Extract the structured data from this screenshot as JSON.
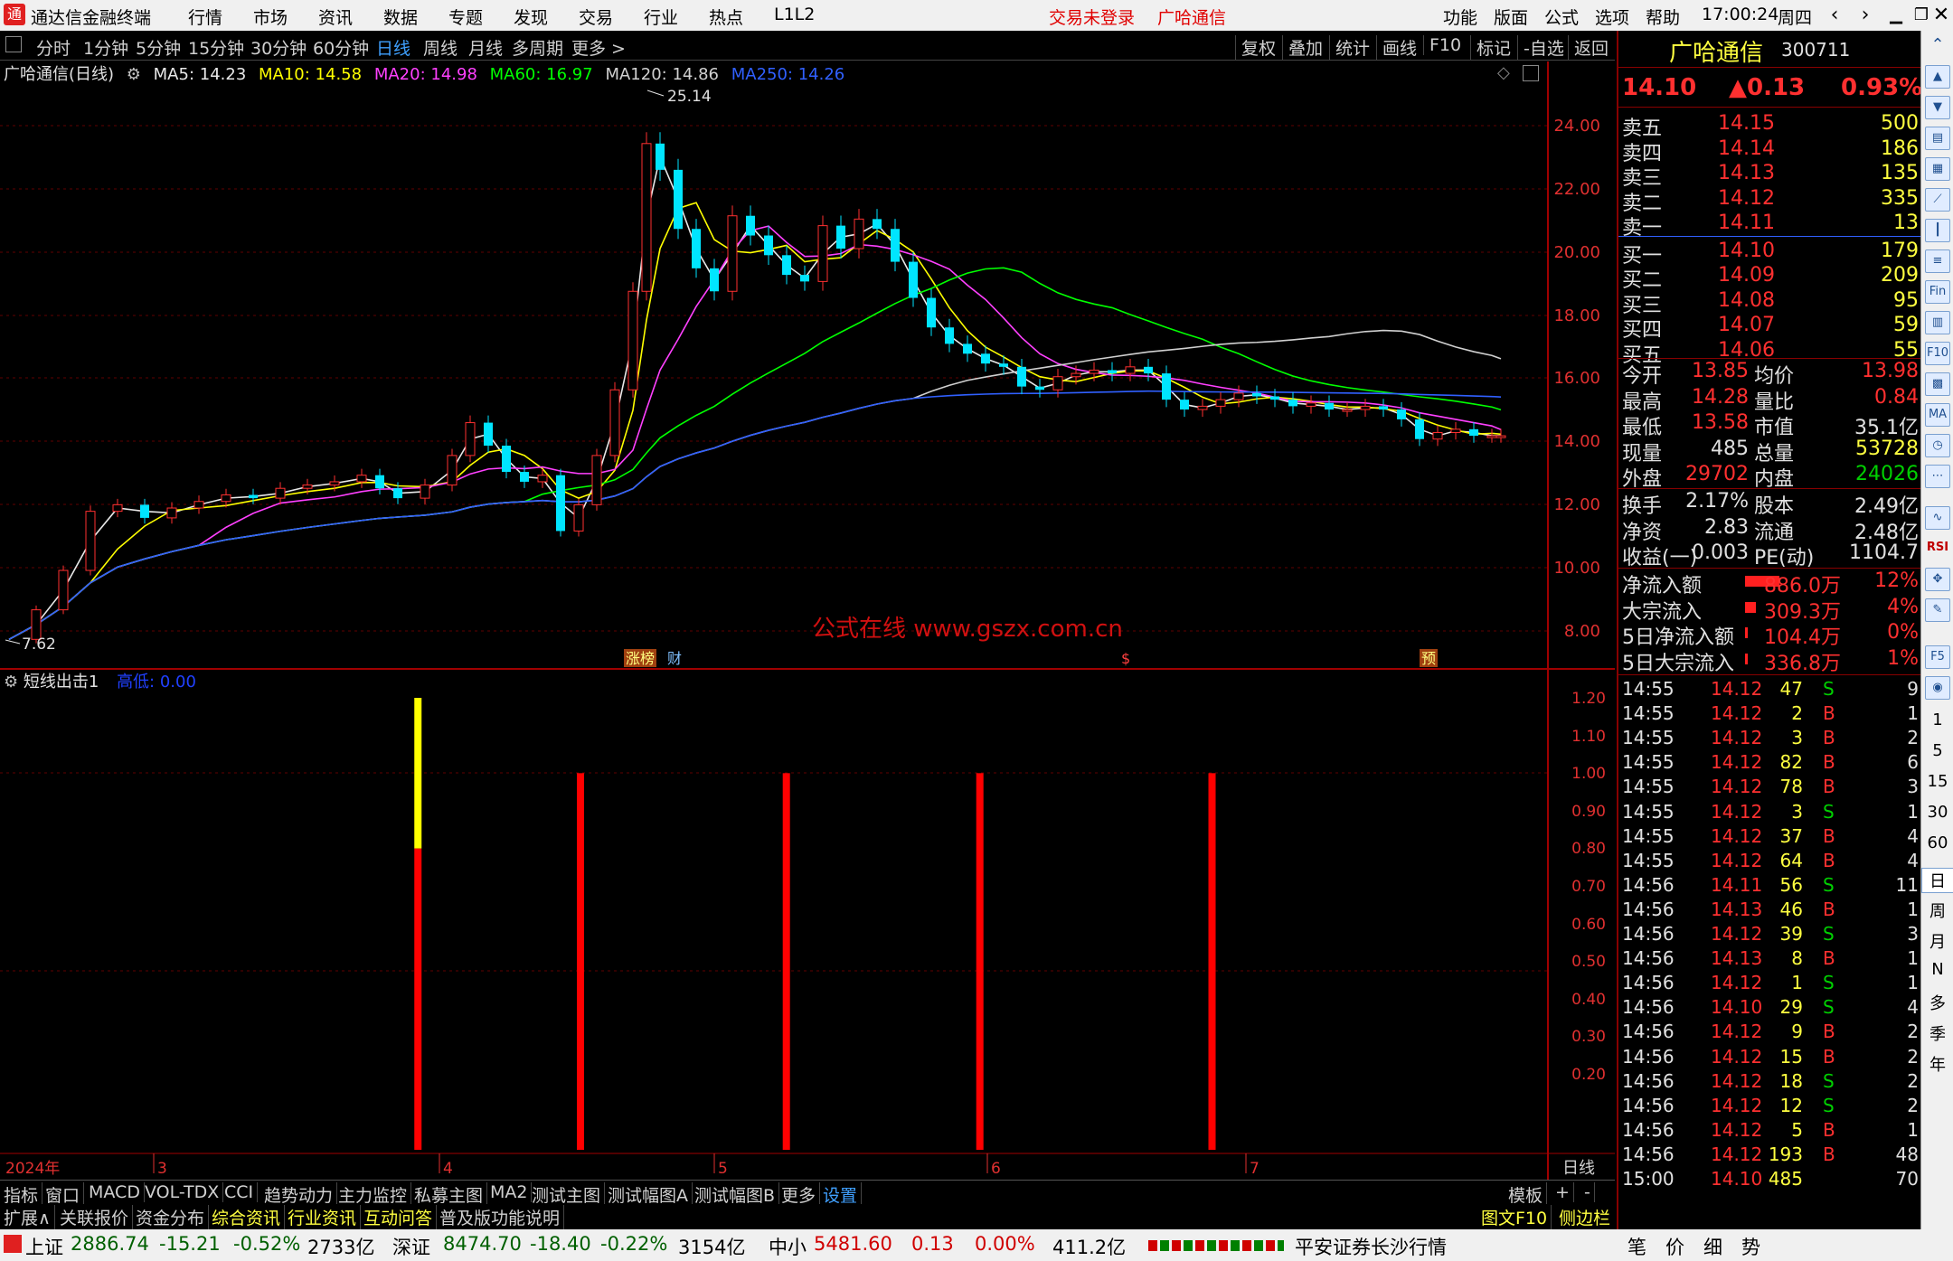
{
  "menubar": {
    "app_title": "通达信金融终端",
    "items": [
      "行情",
      "市场",
      "资讯",
      "数据",
      "专题",
      "发现",
      "交易",
      "行业",
      "热点",
      "L1L2"
    ],
    "trade_status": "交易未登录",
    "stock_name": "广哈通信",
    "right_items": [
      "功能",
      "版面",
      "公式",
      "选项",
      "帮助"
    ],
    "time": "17:00:24",
    "weekday": "周四"
  },
  "periodbar": {
    "periods": [
      "分时",
      "1分钟",
      "5分钟",
      "15分钟",
      "30分钟",
      "60分钟",
      "日线",
      "周线",
      "月线",
      "多周期",
      "更多 >"
    ],
    "active": "日线",
    "right_buttons": [
      "复权",
      "叠加",
      "统计",
      "画线",
      "F10",
      "标记",
      "-自选",
      "返回"
    ]
  },
  "chart": {
    "title": "广哈通信(日线)",
    "ma_legend": [
      {
        "label": "MA5: 14.23",
        "color": "#e8e8e8"
      },
      {
        "label": "MA10: 14.58",
        "color": "#ffff00"
      },
      {
        "label": "MA20: 14.98",
        "color": "#ff40ff"
      },
      {
        "label": "MA60: 16.97",
        "color": "#00ff00"
      },
      {
        "label": "MA120: 14.86",
        "color": "#d0d0d0"
      },
      {
        "label": "MA250: 14.26",
        "color": "#3060ff"
      }
    ],
    "high_label": "25.14",
    "low_label": "7.62",
    "watermark": "公式在线  www.gszx.com.cn",
    "event_markers": [
      "涨榜",
      "财",
      "$",
      "预"
    ],
    "price_axis": [
      "24.00",
      "22.00",
      "20.00",
      "18.00",
      "16.00",
      "14.00",
      "12.00",
      "10.00",
      "8.00"
    ],
    "indicator_title": "短线出击1",
    "indicator_value": "高低: 0.00",
    "indicator_axis": [
      "1.20",
      "1.10",
      "1.00",
      "0.90",
      "0.80",
      "0.70",
      "0.60",
      "0.50",
      "0.40",
      "0.30",
      "0.20"
    ],
    "date_axis": [
      "2024年",
      "3",
      "4",
      "5",
      "6",
      "7"
    ],
    "period_label": "日线",
    "colors": {
      "up": "#ff3030",
      "down": "#00e5ff",
      "ma5": "#e8e8e8",
      "ma10": "#ffff00",
      "ma20": "#ff40ff",
      "ma60": "#00ff00",
      "ma120": "#d0d0d0",
      "ma250": "#3060ff"
    }
  },
  "chart_data": {
    "type": "candlestick",
    "series_ma": [
      "MA5",
      "MA10",
      "MA20",
      "MA60",
      "MA120",
      "MA250"
    ],
    "price_ylim": [
      7.0,
      25.5
    ],
    "indicator": {
      "name": "短线出击1",
      "type": "bar",
      "ylim": [
        0,
        1.25
      ],
      "bars": [
        {
          "pos": 0.27,
          "value": 1.2,
          "split_at": 0.8,
          "top_color": "#ffff00",
          "bottom_color": "#ff0000"
        },
        {
          "pos": 0.375,
          "value": 1.0,
          "color": "#ff0000"
        },
        {
          "pos": 0.508,
          "value": 1.0,
          "color": "#ff0000"
        },
        {
          "pos": 0.633,
          "value": 1.0,
          "color": "#ff0000"
        },
        {
          "pos": 0.783,
          "value": 1.0,
          "color": "#ff0000"
        }
      ]
    }
  },
  "bottombar1": {
    "items": [
      "指标",
      "窗口",
      "MACD",
      "VOL-TDX",
      "CCI",
      "趋势动力",
      "主力监控",
      "私募主图",
      "MA2",
      "测试主图",
      "测试幅图A",
      "测试幅图B",
      "更多",
      "设置"
    ],
    "right": [
      "模板",
      "+",
      "-"
    ]
  },
  "bottombar2": {
    "items": [
      "扩展∧",
      "关联报价",
      "资金分布",
      "综合资讯",
      "行业资讯",
      "互动问答",
      "普及版功能说明"
    ],
    "right": [
      "图文F10",
      "侧边栏《"
    ]
  },
  "statusbar": {
    "sh_name": "上证",
    "sh_value": "2886.74",
    "sh_change": "-15.21",
    "sh_pct": "-0.52%",
    "sh_amount": "2733亿",
    "sz_name": "深证",
    "sz_value": "8474.70",
    "sz_change": "-18.40",
    "sz_pct": "-0.22%",
    "sz_amount": "3154亿",
    "zx_name": "中小",
    "zx_value": "5481.60",
    "zx_change": "0.13",
    "zx_pct": "0.00%",
    "zx_amount": "411.2亿",
    "broker": "平安证券长沙行情",
    "tabs": [
      "笔",
      "价",
      "细",
      "势"
    ]
  },
  "quote": {
    "name": "广哈通信",
    "code": "300711",
    "price": "14.10",
    "change": "▲0.13",
    "pct": "0.93%",
    "sell": [
      {
        "label": "卖五",
        "price": "14.15",
        "vol": "500"
      },
      {
        "label": "卖四",
        "price": "14.14",
        "vol": "186"
      },
      {
        "label": "卖三",
        "price": "14.13",
        "vol": "135"
      },
      {
        "label": "卖二",
        "price": "14.12",
        "vol": "335"
      },
      {
        "label": "卖一",
        "price": "14.11",
        "vol": "13"
      }
    ],
    "buy": [
      {
        "label": "买一",
        "price": "14.10",
        "vol": "179"
      },
      {
        "label": "买二",
        "price": "14.09",
        "vol": "209"
      },
      {
        "label": "买三",
        "price": "14.08",
        "vol": "95"
      },
      {
        "label": "买四",
        "price": "14.07",
        "vol": "59"
      },
      {
        "label": "买五",
        "price": "14.06",
        "vol": "55"
      }
    ],
    "stats": [
      {
        "l1": "今开",
        "v1": "13.85",
        "l2": "均价",
        "v2": "13.98"
      },
      {
        "l1": "最高",
        "v1": "14.28",
        "l2": "量比",
        "v2": "0.84"
      },
      {
        "l1": "最低",
        "v1": "13.58",
        "l2": "市值",
        "v2": "35.1亿"
      },
      {
        "l1": "现量",
        "v1": "485",
        "l2": "总量",
        "v2": "53728"
      },
      {
        "l1": "外盘",
        "v1": "29702",
        "l2": "内盘",
        "v2": "24026"
      }
    ],
    "stats2": [
      {
        "l1": "换手",
        "v1": "2.17%",
        "l2": "股本",
        "v2": "2.49亿"
      },
      {
        "l1": "净资",
        "v1": "2.83",
        "l2": "流通",
        "v2": "2.48亿"
      },
      {
        "l1": "收益(一)",
        "v1": "0.003",
        "l2": "PE(动)",
        "v2": "1104.7"
      }
    ],
    "flows": [
      {
        "label": "净流入额",
        "value": "886.0万",
        "pct": "12%"
      },
      {
        "label": "大宗流入",
        "value": "309.3万",
        "pct": "4%"
      },
      {
        "label": "5日净流入额",
        "value": "104.4万",
        "pct": "0%"
      },
      {
        "label": "5日大宗流入",
        "value": "336.8万",
        "pct": "1%"
      }
    ],
    "ticks": [
      {
        "t": "14:55",
        "p": "14.12",
        "v": "47",
        "s": "S",
        "n": "9"
      },
      {
        "t": "14:55",
        "p": "14.12",
        "v": "2",
        "s": "B",
        "n": "1"
      },
      {
        "t": "14:55",
        "p": "14.12",
        "v": "3",
        "s": "B",
        "n": "2"
      },
      {
        "t": "14:55",
        "p": "14.12",
        "v": "82",
        "s": "B",
        "n": "6"
      },
      {
        "t": "14:55",
        "p": "14.12",
        "v": "78",
        "s": "B",
        "n": "3"
      },
      {
        "t": "14:55",
        "p": "14.12",
        "v": "3",
        "s": "S",
        "n": "1"
      },
      {
        "t": "14:55",
        "p": "14.12",
        "v": "37",
        "s": "B",
        "n": "4"
      },
      {
        "t": "14:55",
        "p": "14.12",
        "v": "64",
        "s": "B",
        "n": "4"
      },
      {
        "t": "14:56",
        "p": "14.11",
        "v": "56",
        "s": "S",
        "n": "11"
      },
      {
        "t": "14:56",
        "p": "14.13",
        "v": "46",
        "s": "B",
        "n": "1"
      },
      {
        "t": "14:56",
        "p": "14.12",
        "v": "39",
        "s": "S",
        "n": "3"
      },
      {
        "t": "14:56",
        "p": "14.13",
        "v": "8",
        "s": "B",
        "n": "1"
      },
      {
        "t": "14:56",
        "p": "14.12",
        "v": "1",
        "s": "S",
        "n": "1"
      },
      {
        "t": "14:56",
        "p": "14.10",
        "v": "29",
        "s": "S",
        "n": "4"
      },
      {
        "t": "14:56",
        "p": "14.12",
        "v": "9",
        "s": "B",
        "n": "2"
      },
      {
        "t": "14:56",
        "p": "14.12",
        "v": "15",
        "s": "B",
        "n": "2"
      },
      {
        "t": "14:56",
        "p": "14.12",
        "v": "18",
        "s": "S",
        "n": "2"
      },
      {
        "t": "14:56",
        "p": "14.12",
        "v": "12",
        "s": "S",
        "n": "2"
      },
      {
        "t": "14:56",
        "p": "14.12",
        "v": "5",
        "s": "B",
        "n": "1"
      },
      {
        "t": "14:56",
        "p": "14.12",
        "v": "193",
        "s": "B",
        "n": "48"
      },
      {
        "t": "15:00",
        "p": "14.10",
        "v": "485",
        "s": "",
        "n": "70"
      }
    ]
  },
  "sidebar": {
    "texts": [
      "1",
      "5",
      "15",
      "30",
      "60",
      "日",
      "周",
      "月",
      "N",
      "多",
      "季",
      "年"
    ]
  }
}
